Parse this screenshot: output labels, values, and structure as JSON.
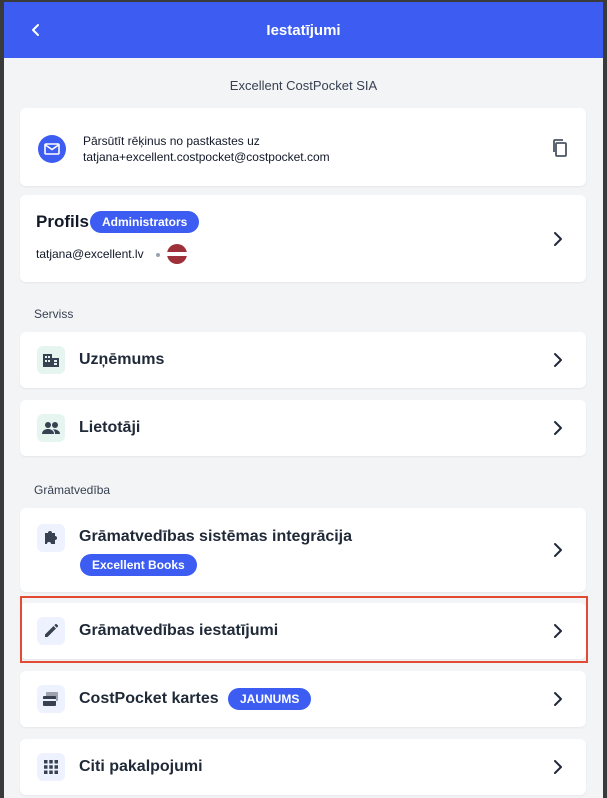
{
  "header": {
    "title": "Iestatījumi"
  },
  "company": {
    "name": "Excellent CostPocket SIA"
  },
  "email_forward": {
    "line1": "Pārsūtīt rēķinus no pastkastes uz",
    "line2": "tatjana+excellent.costpocket@costpocket.com"
  },
  "profile": {
    "title": "Profils",
    "role_badge": "Administrators",
    "email": "tatjana@excellent.lv"
  },
  "sections": {
    "service": {
      "label": "Serviss",
      "items": [
        {
          "label": "Uzņēmums",
          "icon": "building-icon"
        },
        {
          "label": "Lietotāji",
          "icon": "users-icon"
        }
      ]
    },
    "accounting": {
      "label": "Grāmatvedība",
      "items": [
        {
          "label": "Grāmatvedības sistēmas integrācija",
          "badge": "Excellent Books",
          "icon": "puzzle-icon"
        },
        {
          "label": "Grāmatvedības iestatījumi",
          "icon": "pencil-icon"
        },
        {
          "label": "CostPocket kartes",
          "badge": "JAUNUMS",
          "icon": "card-icon"
        },
        {
          "label": "Citi pakalpojumi",
          "icon": "grid-icon"
        }
      ]
    }
  },
  "colors": {
    "primary": "#3c5cf2",
    "highlight_border": "#e24a33",
    "background": "#f3f4f6"
  }
}
